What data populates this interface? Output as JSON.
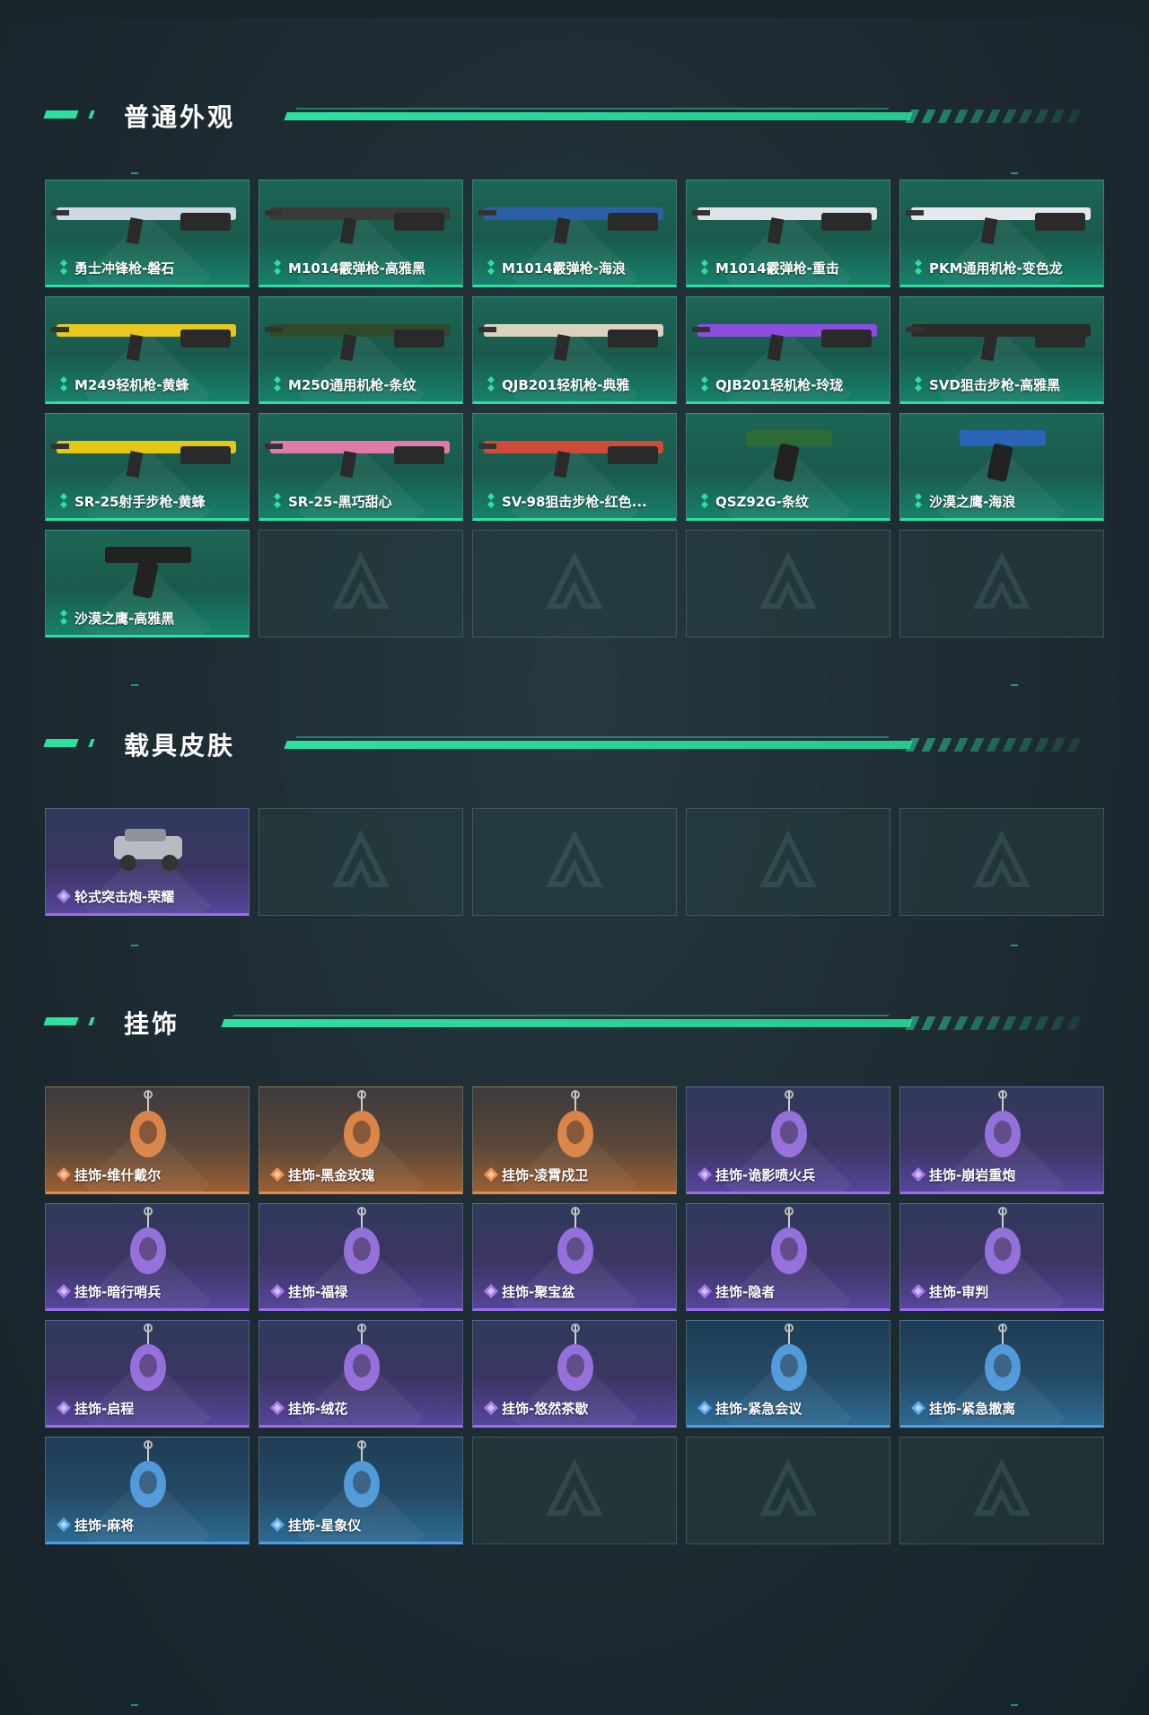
{
  "sections": [
    {
      "title": "普通外观",
      "items": [
        {
          "label": "勇士冲锋枪-磐石",
          "rarity": "green",
          "icon": "rifle-icon"
        },
        {
          "label": "M1014霰弹枪-高雅黑",
          "rarity": "green",
          "icon": "shotgun-icon"
        },
        {
          "label": "M1014霰弹枪-海浪",
          "rarity": "green",
          "icon": "shotgun-icon"
        },
        {
          "label": "M1014霰弹枪-重击",
          "rarity": "green",
          "icon": "shotgun-icon"
        },
        {
          "label": "PKM通用机枪-变色龙",
          "rarity": "green",
          "icon": "machine-gun-icon"
        },
        {
          "label": "M249轻机枪-黄蜂",
          "rarity": "green",
          "icon": "machine-gun-icon"
        },
        {
          "label": "M250通用机枪-条纹",
          "rarity": "green",
          "icon": "machine-gun-icon"
        },
        {
          "label": "QJB201轻机枪-典雅",
          "rarity": "green",
          "icon": "machine-gun-icon"
        },
        {
          "label": "QJB201轻机枪-玲珑",
          "rarity": "green",
          "icon": "machine-gun-icon"
        },
        {
          "label": "SVD狙击步枪-高雅黑",
          "rarity": "green",
          "icon": "sniper-icon"
        },
        {
          "label": "SR-25射手步枪-黄蜂",
          "rarity": "green",
          "icon": "sniper-icon"
        },
        {
          "label": "SR-25-黑巧甜心",
          "rarity": "green",
          "icon": "rifle-icon"
        },
        {
          "label": "SV-98狙击步枪-红色...",
          "rarity": "green",
          "icon": "sniper-icon"
        },
        {
          "label": "QSZ92G-条纹",
          "rarity": "green",
          "icon": "pistol-icon"
        },
        {
          "label": "沙漠之鹰-海浪",
          "rarity": "green",
          "icon": "pistol-icon"
        },
        {
          "label": "沙漠之鹰-高雅黑",
          "rarity": "green",
          "icon": "pistol-icon"
        }
      ],
      "empty_slots": 4
    },
    {
      "title": "载具皮肤",
      "items": [
        {
          "label": "轮式突击炮-荣耀",
          "rarity": "purple",
          "icon": "vehicle-icon"
        }
      ],
      "empty_slots": 4
    },
    {
      "title": "挂饰",
      "items": [
        {
          "label": "挂饰-维什戴尔",
          "rarity": "orange",
          "icon": "charm-icon"
        },
        {
          "label": "挂饰-黑金玫瑰",
          "rarity": "orange",
          "icon": "charm-icon"
        },
        {
          "label": "挂饰-凌霄戍卫",
          "rarity": "orange",
          "icon": "charm-icon"
        },
        {
          "label": "挂饰-诡影喷火兵",
          "rarity": "purple",
          "icon": "charm-icon"
        },
        {
          "label": "挂饰-崩岩重炮",
          "rarity": "purple",
          "icon": "charm-icon"
        },
        {
          "label": "挂饰-暗行哨兵",
          "rarity": "purple",
          "icon": "charm-icon"
        },
        {
          "label": "挂饰-福禄",
          "rarity": "purple",
          "icon": "charm-icon"
        },
        {
          "label": "挂饰-聚宝盆",
          "rarity": "purple",
          "icon": "charm-icon"
        },
        {
          "label": "挂饰-隐者",
          "rarity": "purple",
          "icon": "charm-icon"
        },
        {
          "label": "挂饰-审判",
          "rarity": "purple",
          "icon": "charm-icon"
        },
        {
          "label": "挂饰-启程",
          "rarity": "purple",
          "icon": "charm-icon"
        },
        {
          "label": "挂饰-绒花",
          "rarity": "purple",
          "icon": "charm-icon"
        },
        {
          "label": "挂饰-悠然茶歇",
          "rarity": "purple",
          "icon": "charm-icon"
        },
        {
          "label": "挂饰-紧急会议",
          "rarity": "blue",
          "icon": "charm-icon"
        },
        {
          "label": "挂饰-紧急撤离",
          "rarity": "blue",
          "icon": "charm-icon"
        },
        {
          "label": "挂饰-麻将",
          "rarity": "blue",
          "icon": "charm-icon"
        },
        {
          "label": "挂饰-星象仪",
          "rarity": "blue",
          "icon": "charm-icon"
        }
      ],
      "empty_slots": 3
    }
  ],
  "colors": {
    "accent": "#2ee0a0",
    "green": "#2ee0a0",
    "purple": "#9a6ee8",
    "orange": "#e88a4a",
    "blue": "#4f9ee8"
  }
}
